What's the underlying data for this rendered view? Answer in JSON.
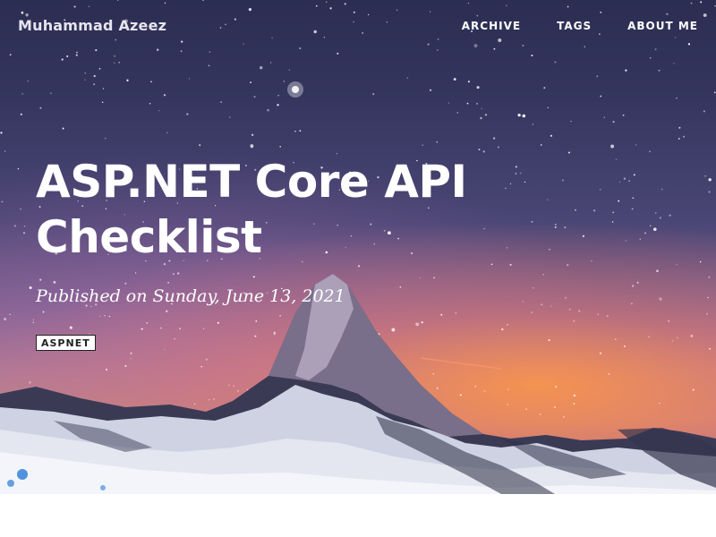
{
  "site": {
    "brand": "Muhammad Azeez"
  },
  "nav": {
    "items": [
      {
        "label": "ARCHIVE"
      },
      {
        "label": "TAGS"
      },
      {
        "label": "ABOUT ME"
      }
    ]
  },
  "post": {
    "title": "ASP.NET Core API Checklist",
    "meta": "Published on Sunday, June 13, 2021",
    "tags": [
      {
        "label": "ASPNET"
      }
    ]
  },
  "colors": {
    "header_text": "#ffffff",
    "tag_background": "#ffffff",
    "tag_border": "#222222",
    "page_background": "#ffffff"
  }
}
